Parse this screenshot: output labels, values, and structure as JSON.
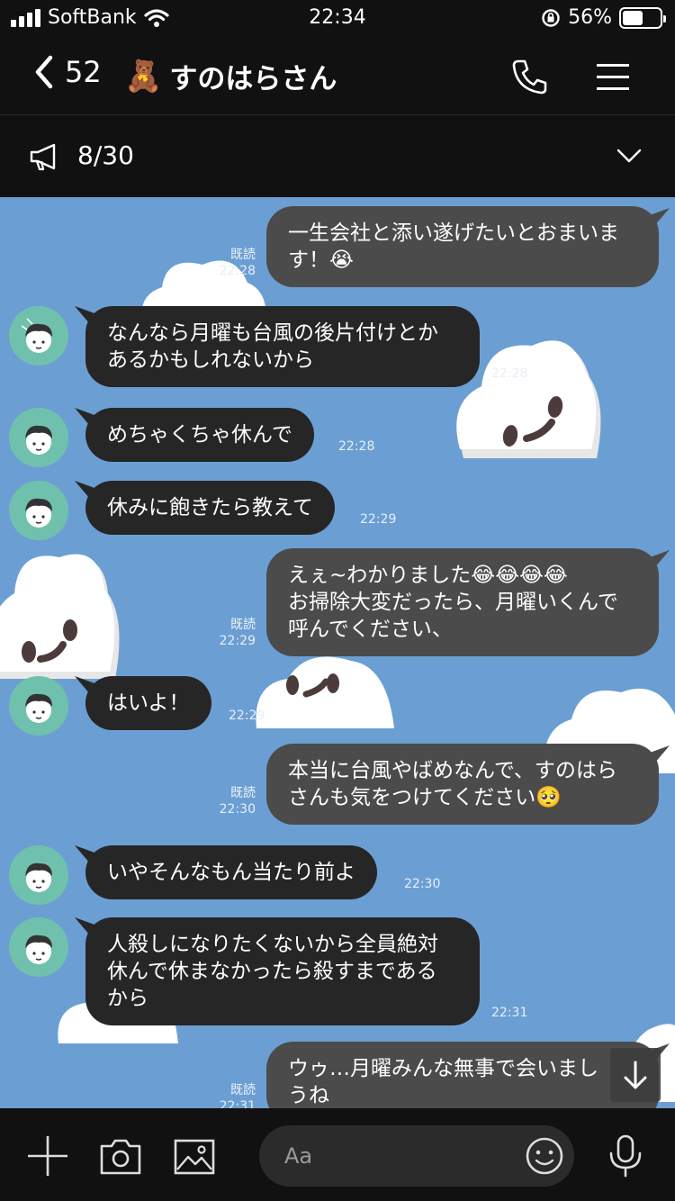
{
  "status_bar": {
    "carrier": "SoftBank",
    "time": "22:34",
    "battery": "56%",
    "battery_level": 0.56
  },
  "header": {
    "back_count": "52",
    "title": "すのはらさん",
    "title_emoji": "🧸",
    "call_icon": "phone-icon",
    "menu_icon": "hamburger-menu-icon"
  },
  "announcement": {
    "icon": "megaphone-icon",
    "count": "8/30",
    "expand_icon": "chevron-down-icon"
  },
  "messages": [
    {
      "side": "mine",
      "text": "一生会社と添い遂げたいとおまいます！😭",
      "read": "既読",
      "time": "22:28"
    },
    {
      "side": "theirs",
      "text": "なんなら月曜も台風の後片付けとか\nあるかもしれないから",
      "time": "22:28"
    },
    {
      "side": "theirs",
      "text": "めちゃくちゃ休んで",
      "time": "22:28"
    },
    {
      "side": "theirs",
      "text": "休みに飽きたら教えて",
      "time": "22:29"
    },
    {
      "side": "mine",
      "text": "えぇ~わかりました😂😂😂😂\nお掃除大変だったら、月曜いくんで\n呼んでください、",
      "read": "既読",
      "time": "22:29"
    },
    {
      "side": "theirs",
      "text": "はいよ！",
      "time": "22:29"
    },
    {
      "side": "mine",
      "text": "本当に台風やばめなんで、すのはら\nさんも気をつけてください🥺",
      "read": "既読",
      "time": "22:30"
    },
    {
      "side": "theirs",
      "text": "いやそんなもん当たり前よ",
      "time": "22:30"
    },
    {
      "side": "theirs",
      "text": "人殺しになりたくないから全員絶対\n休んで休まなかったら殺すまである\nから",
      "time": "22:31"
    },
    {
      "side": "mine",
      "text": "ウゥ…月曜みんな無事で会いまし\nうね",
      "read": "既読",
      "time": "22:31"
    }
  ],
  "input": {
    "placeholder": "Aa"
  },
  "colors": {
    "chat_background": "#6b9fd3",
    "my_bubble": "#4b4b4b",
    "their_bubble": "#262626",
    "bars": "#111111",
    "avatar_bg": "#6fc1ae"
  }
}
